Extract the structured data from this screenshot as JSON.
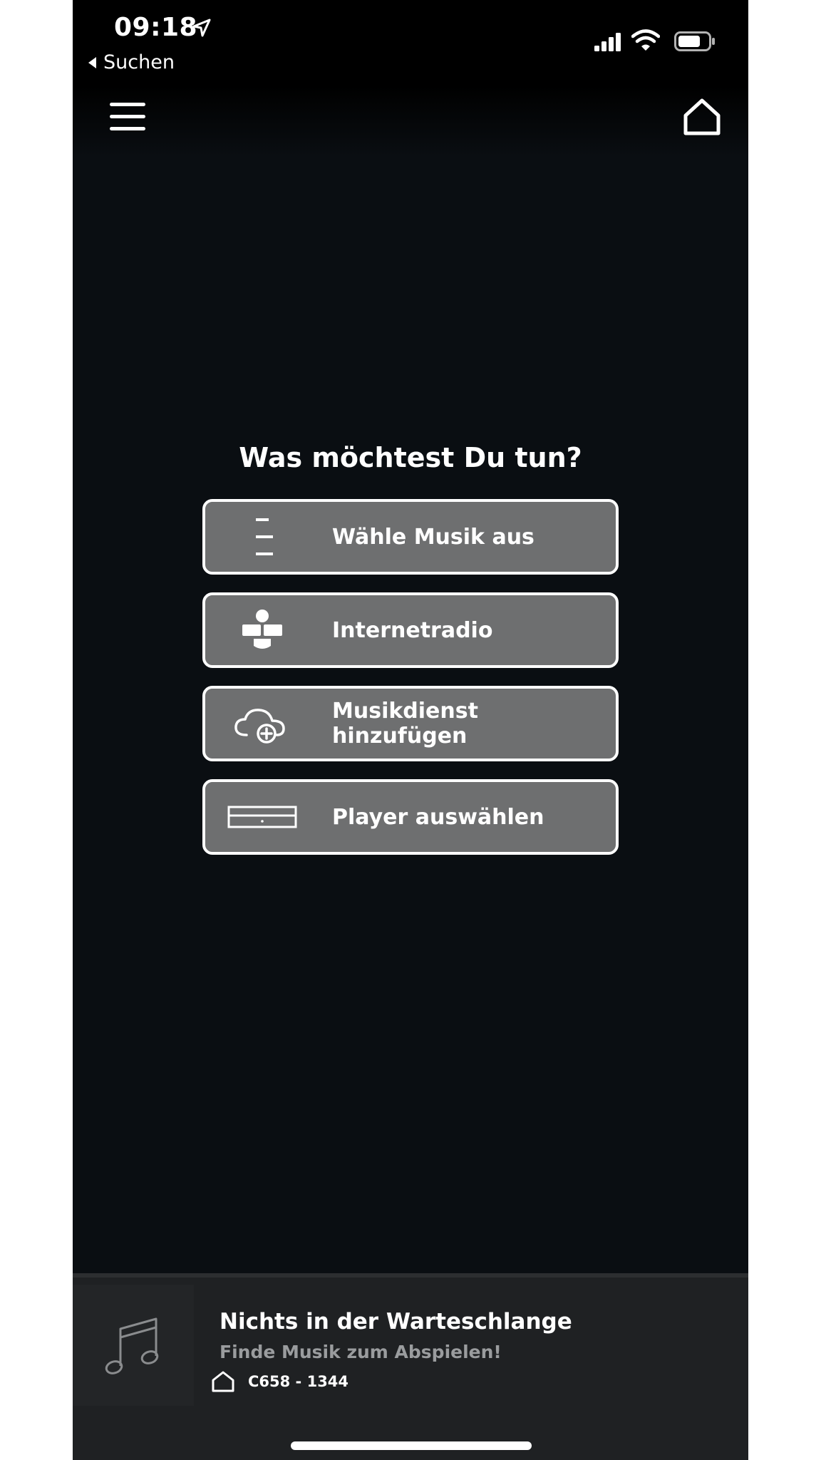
{
  "status_bar": {
    "time": "09:18",
    "back_label": "Suchen"
  },
  "main": {
    "prompt": "Was möchtest Du tun?",
    "actions": [
      {
        "label": "Wähle Musik aus",
        "icon": "list-icon"
      },
      {
        "label": "Internetradio",
        "icon": "tunein-icon"
      },
      {
        "label": "Musikdienst hinzufügen",
        "icon": "cloud-add-icon"
      },
      {
        "label": "Player auswählen",
        "icon": "player-device-icon"
      }
    ]
  },
  "mini_player": {
    "title": "Nichts in der Warteschlange",
    "subtitle": "Finde Musik zum Abspielen!",
    "room": "C658 - 1344"
  },
  "colors": {
    "background": "#0a0e12",
    "button_fill": "#6e6f70",
    "button_border": "#ffffff",
    "text": "#ffffff",
    "subtitle": "#9a9c9e"
  }
}
